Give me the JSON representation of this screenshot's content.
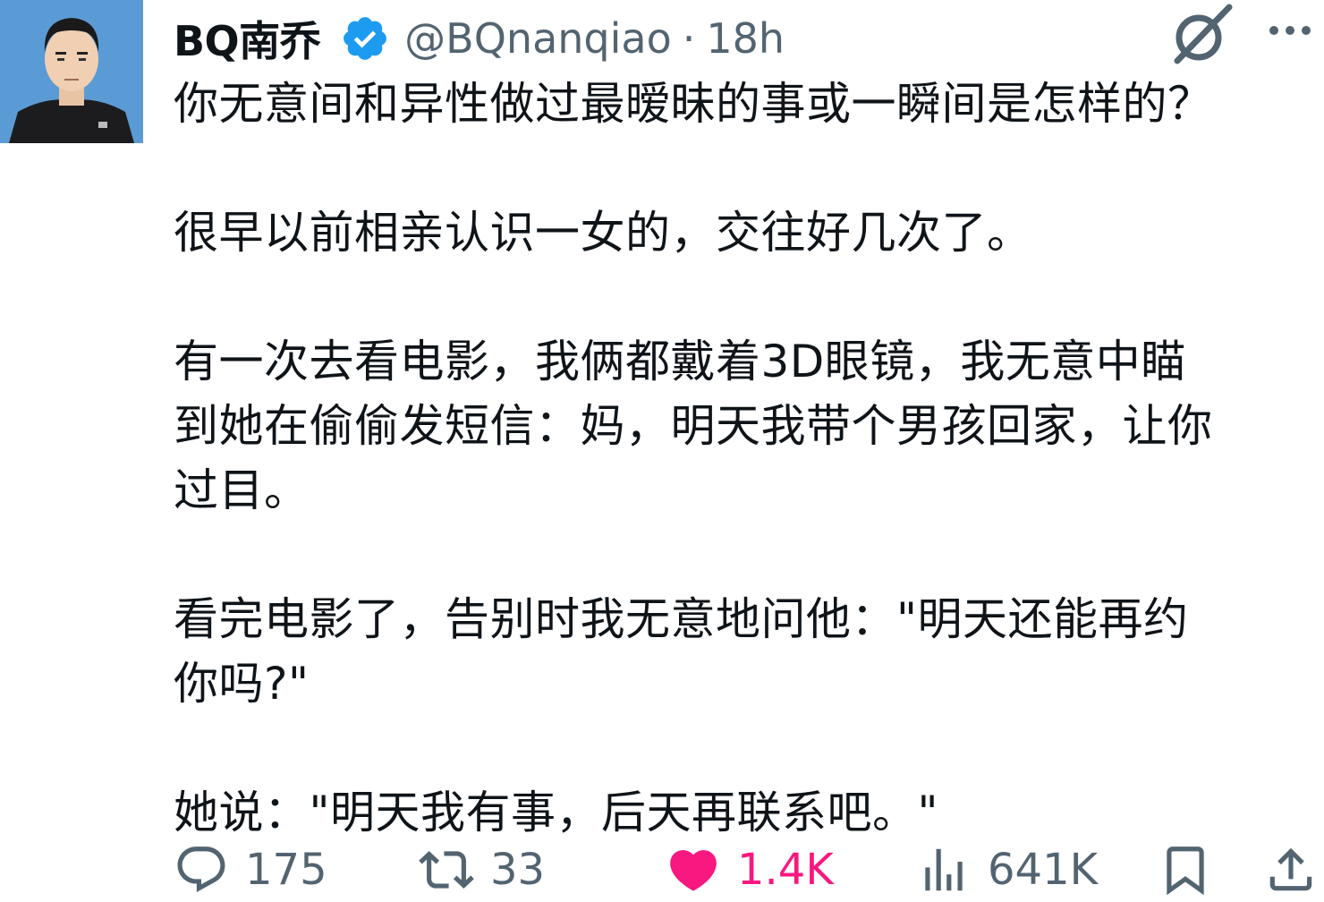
{
  "author": {
    "name": "BQ南乔",
    "handle": "@BQnanqiao",
    "separator": "·",
    "time": "18h",
    "verified": true
  },
  "tweet": {
    "paragraphs": [
      [
        "你无意间和异性做过最暧昧的事或一瞬间是怎样的？"
      ],
      [
        "很早以前相亲认识一女的，交往好几次了。"
      ],
      [
        "有一次去看电影，我俩都戴着3D眼镜，我无意中瞄",
        "到她在偷偷发短信：妈，明天我带个男孩回家，让你",
        "过目。"
      ],
      [
        "看完电影了，告别时我无意地问他：\"明天还能再约",
        "你吗?\""
      ],
      [
        "她说：\"明天我有事，后天再联系吧。\""
      ]
    ]
  },
  "actions": {
    "replies": "175",
    "reposts": "33",
    "likes": "1.4K",
    "views": "641K"
  },
  "icons": {
    "verified": "verified-badge-icon",
    "grok": "grok-icon",
    "more": "more-icon",
    "reply": "reply-icon",
    "repost": "repost-icon",
    "like": "heart-icon",
    "views": "views-icon",
    "bookmark": "bookmark-icon",
    "share": "share-icon"
  },
  "colors": {
    "text": "#0f1419",
    "secondary": "#536471",
    "verified": "#1d9bf0",
    "like": "#f91880"
  }
}
